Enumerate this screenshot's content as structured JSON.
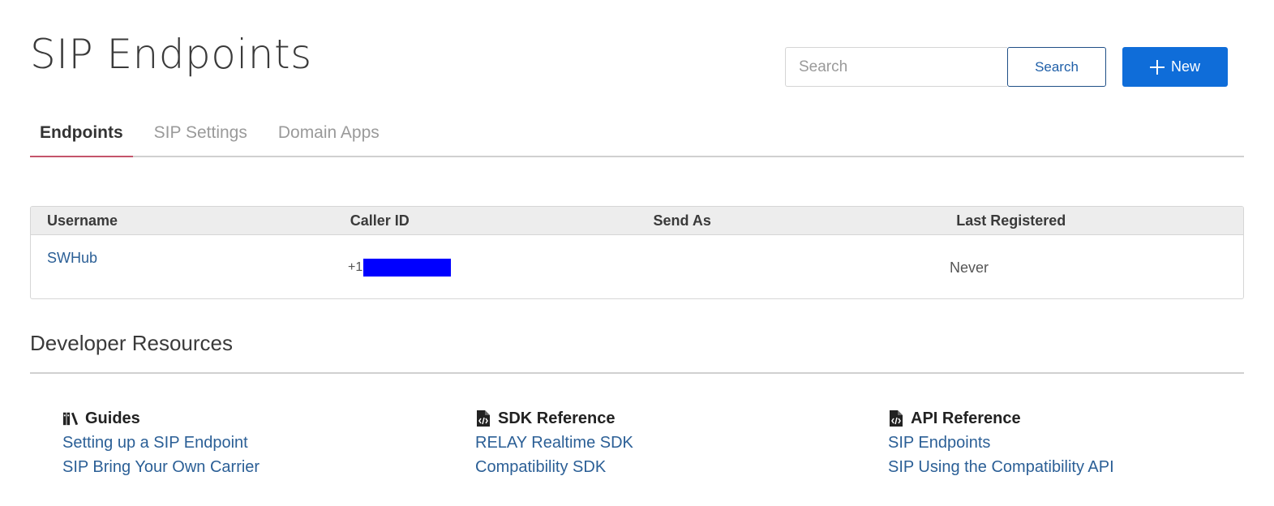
{
  "page": {
    "title": "SIP Endpoints"
  },
  "search": {
    "placeholder": "Search",
    "button_label": "Search"
  },
  "new_button": {
    "label": "New",
    "icon": "plus-icon"
  },
  "tabs": [
    {
      "label": "Endpoints",
      "active": true
    },
    {
      "label": "SIP Settings",
      "active": false
    },
    {
      "label": "Domain Apps",
      "active": false
    }
  ],
  "table": {
    "columns": [
      "Username",
      "Caller ID",
      "Send As",
      "Last Registered"
    ],
    "rows": [
      {
        "username": "SWHub",
        "caller_id_prefix": "+1",
        "send_as": "",
        "last_registered": "Never"
      }
    ]
  },
  "developer_resources": {
    "title": "Developer Resources",
    "sections": [
      {
        "heading": "Guides",
        "icon": "books-icon",
        "links": [
          "Setting up a SIP Endpoint",
          "SIP Bring Your Own Carrier"
        ]
      },
      {
        "heading": "SDK Reference",
        "icon": "code-file-icon",
        "links": [
          "RELAY Realtime SDK",
          "Compatibility SDK"
        ]
      },
      {
        "heading": "API Reference",
        "icon": "code-file-icon",
        "links": [
          "SIP Endpoints",
          "SIP Using the Compatibility API"
        ]
      }
    ]
  },
  "colors": {
    "primary": "#0f6dd9",
    "link": "#2b5f96",
    "active_tab_underline": "#c4546b",
    "redaction": "#0000ff"
  }
}
